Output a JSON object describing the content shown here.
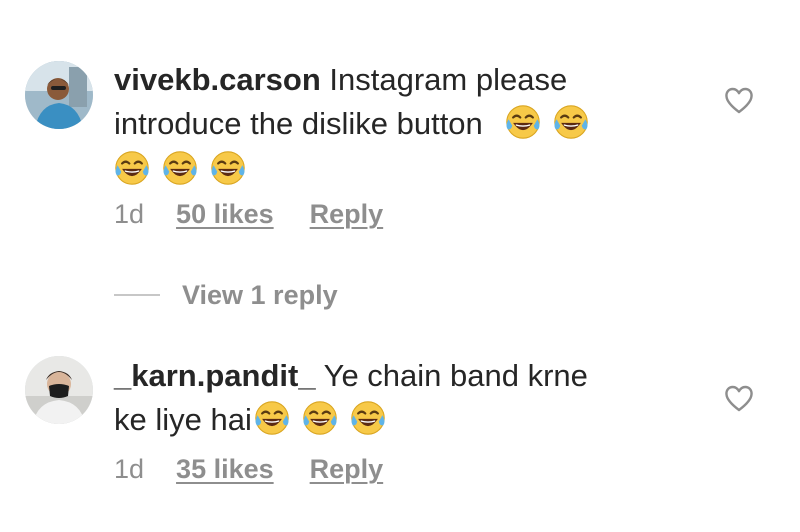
{
  "comments": [
    {
      "username": "vivekb.carson",
      "text_line1": " Instagram please",
      "text_line2": "introduce the dislike button",
      "emoji_name": "face-with-tears-of-joy-icon",
      "time": "1d",
      "likes": "50 likes",
      "reply": "Reply",
      "liked": false
    },
    {
      "username": "_karn.pandit_",
      "text_line1": " Ye chain band krne",
      "text_line2": "ke liye hai",
      "emoji_name": "face-with-tears-of-joy-icon",
      "time": "1d",
      "likes": "35 likes",
      "reply": "Reply",
      "liked": false
    }
  ],
  "view_replies": "View 1 reply",
  "colors": {
    "text": "#262626",
    "secondary": "#8e8e8e",
    "emoji_yellow": "#f7c948",
    "emoji_tear": "#5fb4e8"
  }
}
